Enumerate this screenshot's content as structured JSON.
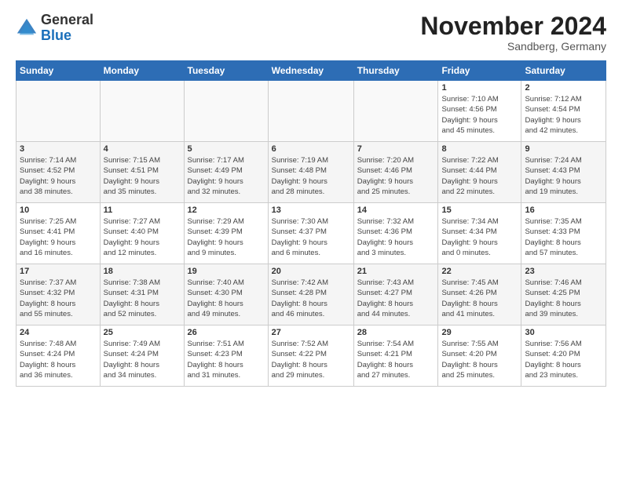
{
  "header": {
    "logo_general": "General",
    "logo_blue": "Blue",
    "month_title": "November 2024",
    "location": "Sandberg, Germany"
  },
  "days_of_week": [
    "Sunday",
    "Monday",
    "Tuesday",
    "Wednesday",
    "Thursday",
    "Friday",
    "Saturday"
  ],
  "weeks": [
    [
      {
        "day": "",
        "info": ""
      },
      {
        "day": "",
        "info": ""
      },
      {
        "day": "",
        "info": ""
      },
      {
        "day": "",
        "info": ""
      },
      {
        "day": "",
        "info": ""
      },
      {
        "day": "1",
        "info": "Sunrise: 7:10 AM\nSunset: 4:56 PM\nDaylight: 9 hours\nand 45 minutes."
      },
      {
        "day": "2",
        "info": "Sunrise: 7:12 AM\nSunset: 4:54 PM\nDaylight: 9 hours\nand 42 minutes."
      }
    ],
    [
      {
        "day": "3",
        "info": "Sunrise: 7:14 AM\nSunset: 4:52 PM\nDaylight: 9 hours\nand 38 minutes."
      },
      {
        "day": "4",
        "info": "Sunrise: 7:15 AM\nSunset: 4:51 PM\nDaylight: 9 hours\nand 35 minutes."
      },
      {
        "day": "5",
        "info": "Sunrise: 7:17 AM\nSunset: 4:49 PM\nDaylight: 9 hours\nand 32 minutes."
      },
      {
        "day": "6",
        "info": "Sunrise: 7:19 AM\nSunset: 4:48 PM\nDaylight: 9 hours\nand 28 minutes."
      },
      {
        "day": "7",
        "info": "Sunrise: 7:20 AM\nSunset: 4:46 PM\nDaylight: 9 hours\nand 25 minutes."
      },
      {
        "day": "8",
        "info": "Sunrise: 7:22 AM\nSunset: 4:44 PM\nDaylight: 9 hours\nand 22 minutes."
      },
      {
        "day": "9",
        "info": "Sunrise: 7:24 AM\nSunset: 4:43 PM\nDaylight: 9 hours\nand 19 minutes."
      }
    ],
    [
      {
        "day": "10",
        "info": "Sunrise: 7:25 AM\nSunset: 4:41 PM\nDaylight: 9 hours\nand 16 minutes."
      },
      {
        "day": "11",
        "info": "Sunrise: 7:27 AM\nSunset: 4:40 PM\nDaylight: 9 hours\nand 12 minutes."
      },
      {
        "day": "12",
        "info": "Sunrise: 7:29 AM\nSunset: 4:39 PM\nDaylight: 9 hours\nand 9 minutes."
      },
      {
        "day": "13",
        "info": "Sunrise: 7:30 AM\nSunset: 4:37 PM\nDaylight: 9 hours\nand 6 minutes."
      },
      {
        "day": "14",
        "info": "Sunrise: 7:32 AM\nSunset: 4:36 PM\nDaylight: 9 hours\nand 3 minutes."
      },
      {
        "day": "15",
        "info": "Sunrise: 7:34 AM\nSunset: 4:34 PM\nDaylight: 9 hours\nand 0 minutes."
      },
      {
        "day": "16",
        "info": "Sunrise: 7:35 AM\nSunset: 4:33 PM\nDaylight: 8 hours\nand 57 minutes."
      }
    ],
    [
      {
        "day": "17",
        "info": "Sunrise: 7:37 AM\nSunset: 4:32 PM\nDaylight: 8 hours\nand 55 minutes."
      },
      {
        "day": "18",
        "info": "Sunrise: 7:38 AM\nSunset: 4:31 PM\nDaylight: 8 hours\nand 52 minutes."
      },
      {
        "day": "19",
        "info": "Sunrise: 7:40 AM\nSunset: 4:30 PM\nDaylight: 8 hours\nand 49 minutes."
      },
      {
        "day": "20",
        "info": "Sunrise: 7:42 AM\nSunset: 4:28 PM\nDaylight: 8 hours\nand 46 minutes."
      },
      {
        "day": "21",
        "info": "Sunrise: 7:43 AM\nSunset: 4:27 PM\nDaylight: 8 hours\nand 44 minutes."
      },
      {
        "day": "22",
        "info": "Sunrise: 7:45 AM\nSunset: 4:26 PM\nDaylight: 8 hours\nand 41 minutes."
      },
      {
        "day": "23",
        "info": "Sunrise: 7:46 AM\nSunset: 4:25 PM\nDaylight: 8 hours\nand 39 minutes."
      }
    ],
    [
      {
        "day": "24",
        "info": "Sunrise: 7:48 AM\nSunset: 4:24 PM\nDaylight: 8 hours\nand 36 minutes."
      },
      {
        "day": "25",
        "info": "Sunrise: 7:49 AM\nSunset: 4:24 PM\nDaylight: 8 hours\nand 34 minutes."
      },
      {
        "day": "26",
        "info": "Sunrise: 7:51 AM\nSunset: 4:23 PM\nDaylight: 8 hours\nand 31 minutes."
      },
      {
        "day": "27",
        "info": "Sunrise: 7:52 AM\nSunset: 4:22 PM\nDaylight: 8 hours\nand 29 minutes."
      },
      {
        "day": "28",
        "info": "Sunrise: 7:54 AM\nSunset: 4:21 PM\nDaylight: 8 hours\nand 27 minutes."
      },
      {
        "day": "29",
        "info": "Sunrise: 7:55 AM\nSunset: 4:20 PM\nDaylight: 8 hours\nand 25 minutes."
      },
      {
        "day": "30",
        "info": "Sunrise: 7:56 AM\nSunset: 4:20 PM\nDaylight: 8 hours\nand 23 minutes."
      }
    ]
  ]
}
